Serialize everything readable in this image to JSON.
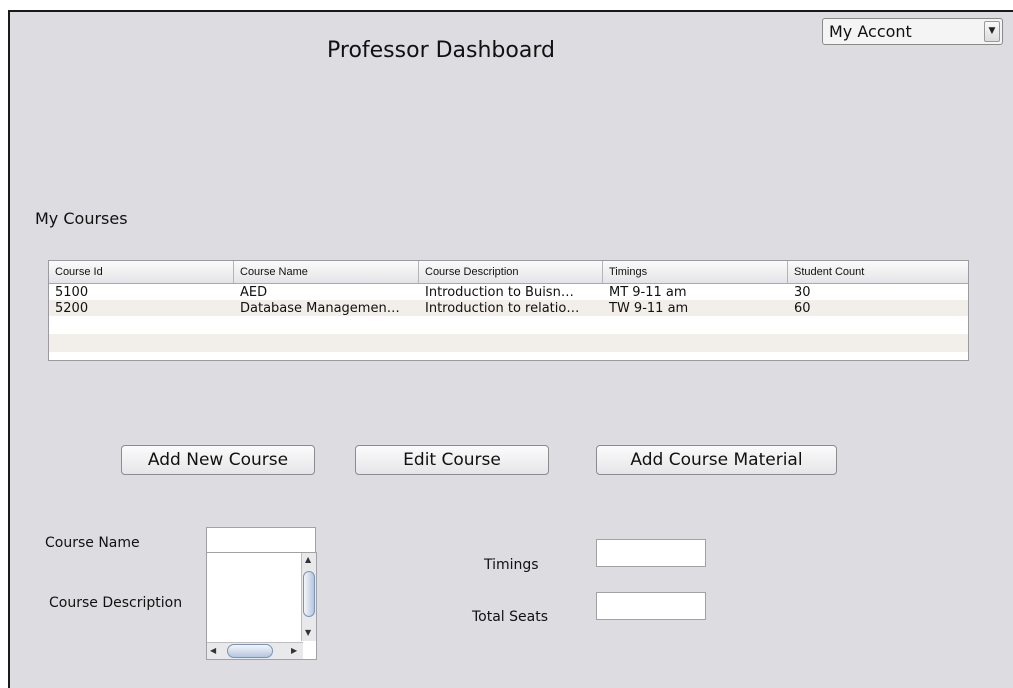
{
  "header": {
    "title": "Professor Dashboard",
    "account_dropdown": {
      "selected": "My Accont",
      "arrow_icon": "triangle-down-icon"
    }
  },
  "courses": {
    "section_label": "My Courses",
    "columns": [
      "Course Id",
      "Course Name",
      "Course Description",
      "Timings",
      "Student Count"
    ],
    "rows": [
      [
        "5100",
        "AED",
        "Introduction to Buisn…",
        "MT 9-11 am",
        "30"
      ],
      [
        "5200",
        "Database Managemen…",
        "Introduction to relatio…",
        "TW 9-11 am",
        "60"
      ]
    ]
  },
  "actions": {
    "add_new_course": "Add New Course",
    "edit_course": "Edit Course",
    "add_course_material": "Add Course Material"
  },
  "form": {
    "course_name_label": "Course Name",
    "course_name_value": "",
    "course_description_label": "Course Description",
    "course_description_value": "",
    "timings_label": "Timings",
    "timings_value": "",
    "total_seats_label": "Total Seats",
    "total_seats_value": ""
  },
  "colors": {
    "window_background": "#dddce1",
    "table_alt_row": "#f2eeea",
    "scroll_thumb": "#b4c6e0"
  }
}
